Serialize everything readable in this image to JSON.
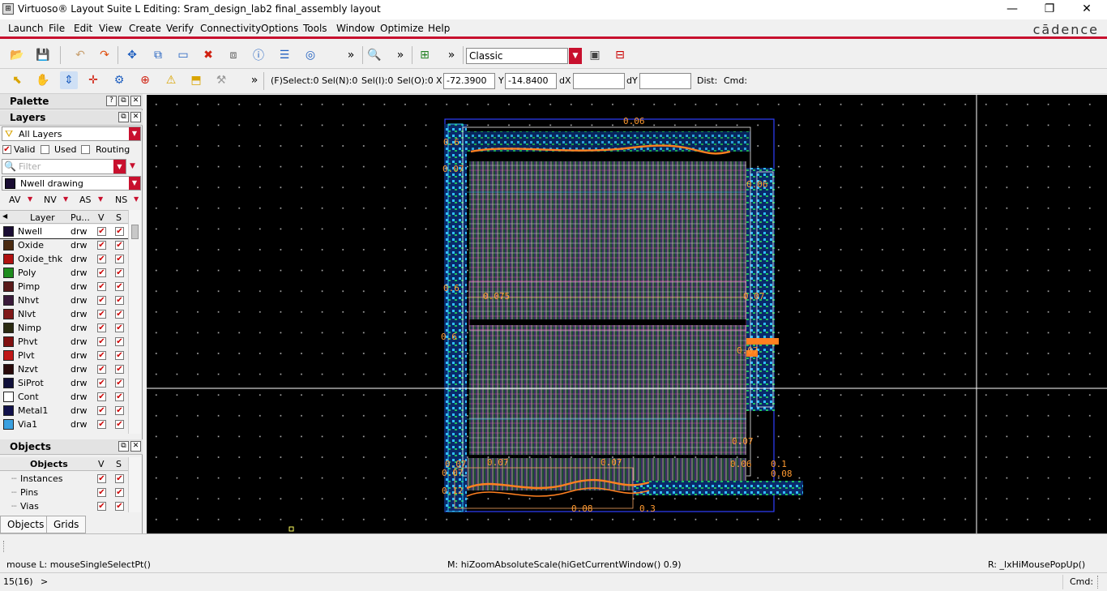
{
  "window": {
    "title": "Virtuoso® Layout Suite L Editing: Sram_design_lab2 final_assembly layout",
    "min": "—",
    "max": "❐",
    "close": "✕"
  },
  "brand": "cādence",
  "menu": [
    "Launch",
    "File",
    "Edit",
    "View",
    "Create",
    "Verify",
    "Connectivity",
    "Options",
    "Tools",
    "Window",
    "Optimize",
    "Help"
  ],
  "toolbar": {
    "workspace": "Classic",
    "more": "»",
    "fselect": "(F)Select:0",
    "seln": "Sel(N):0",
    "seli": "Sel(I):0",
    "selo": "Sel(O):0",
    "x_label": "X",
    "x_value": "-72.3900",
    "y_label": "Y",
    "y_value": "-14.8400",
    "dx_label": "dX",
    "dy_label": "dY",
    "dist_label": "Dist:",
    "cmd_label": "Cmd:"
  },
  "palette": {
    "title": "Palette",
    "help": "?"
  },
  "layers": {
    "title": "Layers",
    "filter_mode": "All Layers",
    "valid": "Valid",
    "used": "Used",
    "routing": "Routing",
    "filter_placeholder": "Filter",
    "current": "Nwell drawing",
    "vis_buttons": [
      "AV",
      "NV",
      "AS",
      "NS"
    ],
    "columns": [
      "Layer",
      "Pu...",
      "V",
      "S"
    ],
    "rows": [
      {
        "name": "Nwell",
        "purpose": "drw",
        "color": "#1a0d33"
      },
      {
        "name": "Oxide",
        "purpose": "drw",
        "color": "#4a2a10"
      },
      {
        "name": "Oxide_thk",
        "purpose": "drw",
        "color": "#b01010"
      },
      {
        "name": "Poly",
        "purpose": "drw",
        "color": "#1e8c1e"
      },
      {
        "name": "Pimp",
        "purpose": "drw",
        "color": "#5a1a1a"
      },
      {
        "name": "Nhvt",
        "purpose": "drw",
        "color": "#3a1a3a"
      },
      {
        "name": "Nlvt",
        "purpose": "drw",
        "color": "#801818"
      },
      {
        "name": "Nimp",
        "purpose": "drw",
        "color": "#2a2a10"
      },
      {
        "name": "Phvt",
        "purpose": "drw",
        "color": "#801010"
      },
      {
        "name": "Plvt",
        "purpose": "drw",
        "color": "#c01818"
      },
      {
        "name": "Nzvt",
        "purpose": "drw",
        "color": "#2a0a0a"
      },
      {
        "name": "SiProt",
        "purpose": "drw",
        "color": "#10103a"
      },
      {
        "name": "Cont",
        "purpose": "drw",
        "color": "#ffffff"
      },
      {
        "name": "Metal1",
        "purpose": "drw",
        "color": "#10104a"
      },
      {
        "name": "Via1",
        "purpose": "drw",
        "color": "#3aa0e0"
      }
    ]
  },
  "objects": {
    "title": "Objects",
    "columns": [
      "Objects",
      "V",
      "S"
    ],
    "rows": [
      "Instances",
      "Pins",
      "Vias"
    ]
  },
  "tabs": [
    "Objects",
    "Grids"
  ],
  "status": {
    "mouse_left": "mouse L: mouseSingleSelectPt()",
    "mouse_mid": "M: hiZoomAbsoluteScale(hiGetCurrentWindow() 0.9)",
    "mouse_right": "R: _lxHiMousePopUp()",
    "counter": "15(16)",
    "prompt": ">",
    "cmd": "Cmd:"
  },
  "layout_labels": [
    "0.06",
    "0.6",
    "0.07",
    "0.06",
    "0.6",
    "0.075",
    "0.07",
    "0.6",
    "0.07",
    "0.1",
    "0.08",
    "0.12",
    "0.08",
    "0.3",
    "0.07",
    "0.07",
    "0.07",
    "0.06",
    "0.07",
    "0.07"
  ],
  "colors": {
    "accent": "#c8102e",
    "canvas": "#000000"
  }
}
